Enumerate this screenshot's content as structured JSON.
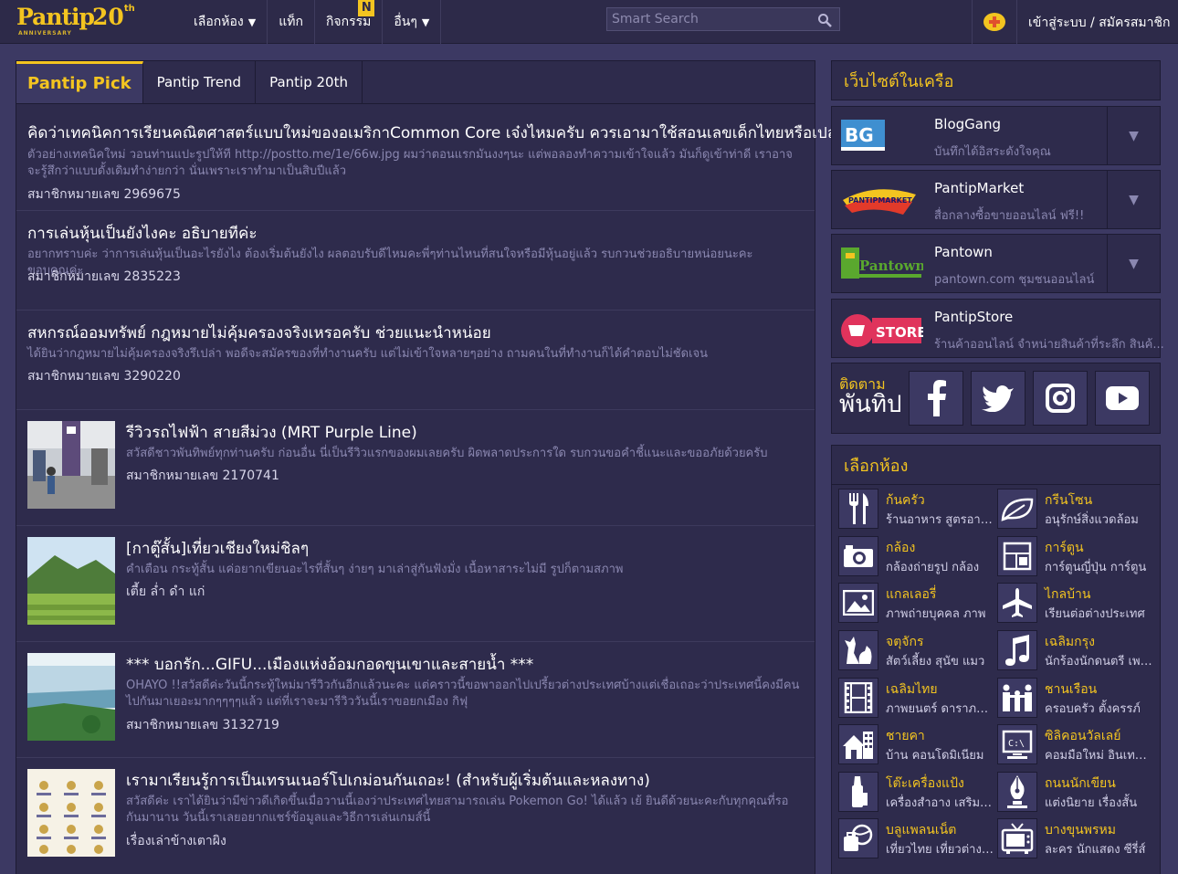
{
  "brand": {
    "logo_text": "Pantip",
    "logo_number": "20",
    "logo_suffix": "th",
    "logo_tag": "ANNIVERSARY"
  },
  "topnav": {
    "items": [
      {
        "label": "เลือกห้อง",
        "caret": true
      },
      {
        "label": "แท็ก",
        "caret": false
      },
      {
        "label": "กิจกรรม",
        "caret": false,
        "badge": "N"
      },
      {
        "label": "อื่นๆ",
        "caret": true
      }
    ],
    "search_placeholder": "Smart Search",
    "login_label": "เข้าสู่ระบบ / สมัครสมาชิก"
  },
  "tabs": [
    {
      "label": "Pantip Pick",
      "active": true
    },
    {
      "label": "Pantip Trend",
      "active": false
    },
    {
      "label": "Pantip 20th",
      "active": false
    }
  ],
  "topics": [
    {
      "title": "คิดว่าเทคนิคการเรียนคณิตศาสตร์แบบใหม่ของอเมริกาCommon Core เจ๋งไหมครับ ควรเอามาใช้สอนเลขเด็กไทยหรือเปล่า",
      "desc": "ตัวอย่างเทคนิคใหม่ วอนท่านแปะรูปให้ที http://postto.me/1e/66w.jpg ผมว่าตอนแรกมันงงๆนะ แต่พอลองทำความเข้าใจแล้ว มันก็ดูเข้าท่าดี เราอาจจะรู้สึกว่าแบบดั้งเดิมทำง่ายกว่า นั่นเพราะเราทำมาเป็นสิบปีแล้ว",
      "author": "สมาชิกหมายเลข 2969675"
    },
    {
      "title": "การเล่นหุ้นเป็นยังไงคะ อธิบายทีค่ะ",
      "desc": "อยากทราบค่ะ ว่าการเล่นหุ้นเป็นอะไรยังไง ต้องเริ่มต้นยังไง ผลตอบรับดีไหมคะพี่ๆท่านไหนที่สนใจหรือมีหุ้นอยู่แล้ว รบกวนช่วยอธิบายหน่อยนะคะ ขอบคุณค่ะ",
      "author": "สมาชิกหมายเลข 2835223"
    },
    {
      "title": "สหกรณ์ออมทรัพย์ กฎหมายไม่คุ้มครองจริงเหรอครับ ช่วยแนะนำหน่อย",
      "desc": "ได้ยินว่ากฎหมายไม่คุ้มครองจริงรึเปล่า พอดีจะสมัครของที่ทำงานครับ แต่ไม่เข้าใจหลายๆอย่าง ถามคนในที่ทำงานก็ได้คำตอบไม่ชัดเจน",
      "author": "สมาชิกหมายเลข 3290220"
    },
    {
      "title": "รีวิวรถไฟฟ้า สายสีม่วง (MRT Purple Line)",
      "desc": "สวัสดีชาวพันทิพย์ทุกท่านครับ ก่อนอื่น นี่เป็นรีวิวแรกของผมเลยครับ ผิดพลาดประการใด รบกวนขอคำชี้แนะและขออภัยด้วยครับ",
      "author": "สมาชิกหมายเลข 2170741"
    },
    {
      "title": "[กาตู๊สั้น]เที่ยวเชียงใหม่ชิลๆ",
      "desc": "คำเตือน กระทู้สั้น แค่อยากเขียนอะไรที่สั้นๆ ง่ายๆ มาเล่าสู่กันฟังมั่ง เนื้อหาสาระไม่มี รูปก็ตามสภาพ",
      "author": "เตี้ย ล่ำ ดำ แก่"
    },
    {
      "title": "*** บอกรัก...GIFU...เมืองแห่งอ้อมกอดขุนเขาและสายน้ำ ***",
      "desc": "OHAYO !!สวัสดีค่ะวันนี้กระทู้ใหม่มารีวิวกันอีกแล้วนะคะ แต่คราวนี้ขอพาออกไปเปรี้ยวต่างประเทศบ้างแต่เชื่อเถอะว่าประเทศนี้คงมีคนไปกันมาเยอะมากๆๆๆๆแล้ว แต่ที่เราจะมารีวิววันนี้เราขอยกเมือง กิฟุ",
      "author": "สมาชิกหมายเลข 3132719"
    },
    {
      "title": "เรามาเรียนรู้การเป็นเทรนเนอร์โปเกม่อนกันเถอะ! (สำหรับผู้เริ่มต้นและหลงทาง)",
      "desc": "สวัสดีค่ะ เราได้ยินว่ามีข่าวดีเกิดขึ้นเมื่อวานนี้เองว่าประเทศไทยสามารถเล่น Pokemon Go! ได้แล้ว เย้ ยินดีด้วยนะคะกับทุกคุณที่รอกันมานาน วันนี้เราเลยอยากแชร์ข้อมูลและวิธีการเล่นเกมส์นี้",
      "author": "เรื่องเล่าข้างเตาผิง"
    }
  ],
  "network": {
    "title": "เว็บไซต์ในเครือ",
    "items": [
      {
        "name": "BlogGang",
        "sub": "บันทึกได้อิสระดังใจคุณ",
        "logo": "bloggang-logo",
        "dropdown": true
      },
      {
        "name": "PantipMarket",
        "sub": "สื่อกลางซื้อขายออนไลน์ ฟรี!!",
        "logo": "pantipmarket-logo",
        "dropdown": true
      },
      {
        "name": "Pantown",
        "sub": "pantown.com ชุมชนออนไลน์",
        "logo": "pantown-logo",
        "dropdown": true
      },
      {
        "name": "PantipStore",
        "sub": "ร้านค้าออนไลน์ จำหน่ายสินค้าที่ระลึก สินค้...",
        "logo": "pantipstore-logo",
        "dropdown": false
      }
    ]
  },
  "follow": {
    "label_small": "ติดตาม",
    "label_big": "พันทิป",
    "icons": [
      "facebook-icon",
      "twitter-icon",
      "instagram-icon",
      "youtube-icon"
    ]
  },
  "rooms": {
    "title": "เลือกห้อง",
    "items": [
      {
        "name": "ก้นครัว",
        "sub": "ร้านอาหาร สูตรอาหาร",
        "icon": "fork-knife-icon"
      },
      {
        "name": "กรีนโซน",
        "sub": "อนุรักษ์สิ่งแวดล้อม",
        "icon": "leaf-icon"
      },
      {
        "name": "กล้อง",
        "sub": "กล้องถ่ายรูป กล้อง",
        "icon": "camera-icon"
      },
      {
        "name": "การ์ตูน",
        "sub": "การ์ตูนญี่ปุ่น การ์ตูน",
        "icon": "comic-icon"
      },
      {
        "name": "แกลเลอรี่",
        "sub": "ภาพถ่ายบุคคล ภาพ",
        "icon": "picture-icon"
      },
      {
        "name": "ไกลบ้าน",
        "sub": "เรียนต่อต่างประเทศ",
        "icon": "airplane-icon"
      },
      {
        "name": "จตุจักร",
        "sub": "สัตว์เลี้ยง สุนัข แมว",
        "icon": "pets-icon"
      },
      {
        "name": "เฉลิมกรุง",
        "sub": "นักร้องนักดนตรี เพลง",
        "icon": "music-note-icon"
      },
      {
        "name": "เฉลิมไทย",
        "sub": "ภาพยนตร์ ดาราภาพยนตร์",
        "icon": "film-icon"
      },
      {
        "name": "ชานเรือน",
        "sub": "ครอบครัว ตั้งครรภ์",
        "icon": "family-icon"
      },
      {
        "name": "ชายคา",
        "sub": "บ้าน คอนโดมิเนียม",
        "icon": "house-icon"
      },
      {
        "name": "ซิลิคอนวัลเลย์",
        "sub": "คอมมือใหม่ อินเทอร์เน็ต",
        "icon": "computer-icon"
      },
      {
        "name": "โต๊ะเครื่องแป้ง",
        "sub": "เครื่องสำอาง เสริมสวย",
        "icon": "cosmetic-icon"
      },
      {
        "name": "ถนนนักเขียน",
        "sub": "แต่งนิยาย เรื่องสั้น",
        "icon": "pen-nib-icon"
      },
      {
        "name": "บลูแพลนเน็ต",
        "sub": "เที่ยวไทย เที่ยวต่างประเทศ",
        "icon": "travel-icon"
      },
      {
        "name": "บางขุนพรหม",
        "sub": "ละคร นักแสดง ซีรี่ส์",
        "icon": "tv-icon"
      }
    ]
  },
  "colors": {
    "accent": "#f3c420",
    "bg": "#3c3963",
    "panel": "#2e2b4c",
    "topbar": "#2d2a49",
    "muted": "#8a87b0"
  }
}
